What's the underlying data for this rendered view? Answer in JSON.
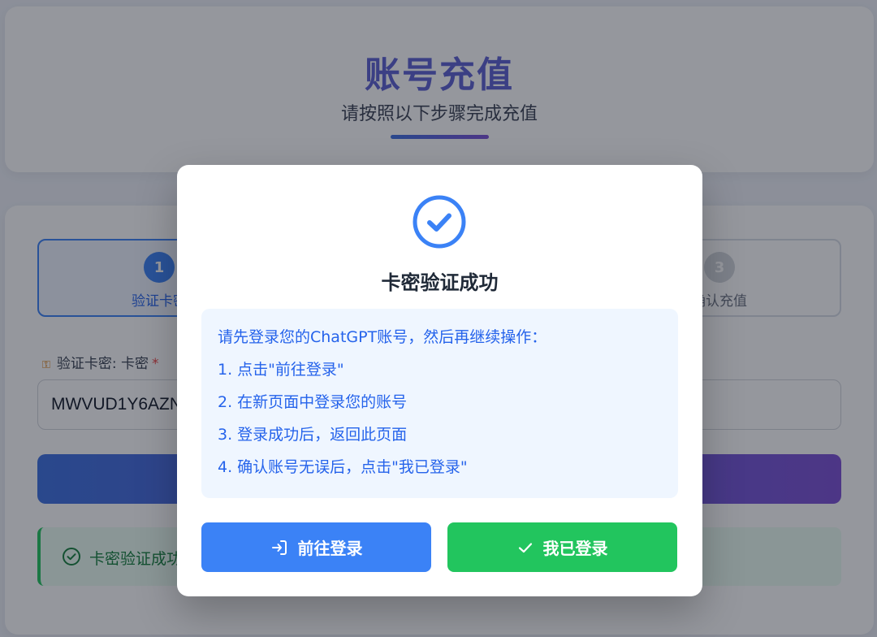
{
  "header": {
    "title": "账号充值",
    "subtitle": "请按照以下步骤完成充值"
  },
  "steps": [
    {
      "number": "1",
      "label": "验证卡密",
      "state": "active"
    },
    {
      "number": "3",
      "label": "确认充值",
      "state": "inactive"
    }
  ],
  "form": {
    "label": "验证卡密: 卡密",
    "required_mark": "*",
    "card_value": "MWVUD1Y6AZN"
  },
  "alert": {
    "text": "卡密验证成功"
  },
  "modal": {
    "title": "卡密验证成功",
    "instructions": [
      "请先登录您的ChatGPT账号，然后再继续操作：",
      "1. 点击\"前往登录\"",
      "2. 在新页面中登录您的账号",
      "3. 登录成功后，返回此页面",
      "4. 确认账号无误后，点击\"我已登录\""
    ],
    "login_button": "前往登录",
    "done_button": "我已登录"
  },
  "colors": {
    "primary": "#3b82f6",
    "success": "#22c55e",
    "gradient_start": "#3b6fe0",
    "gradient_end": "#7c4fd6"
  },
  "icons": {
    "modal": "check-circle-icon",
    "login": "login-icon",
    "done": "check-icon",
    "alert": "check-circle-icon",
    "field": "key-icon"
  }
}
